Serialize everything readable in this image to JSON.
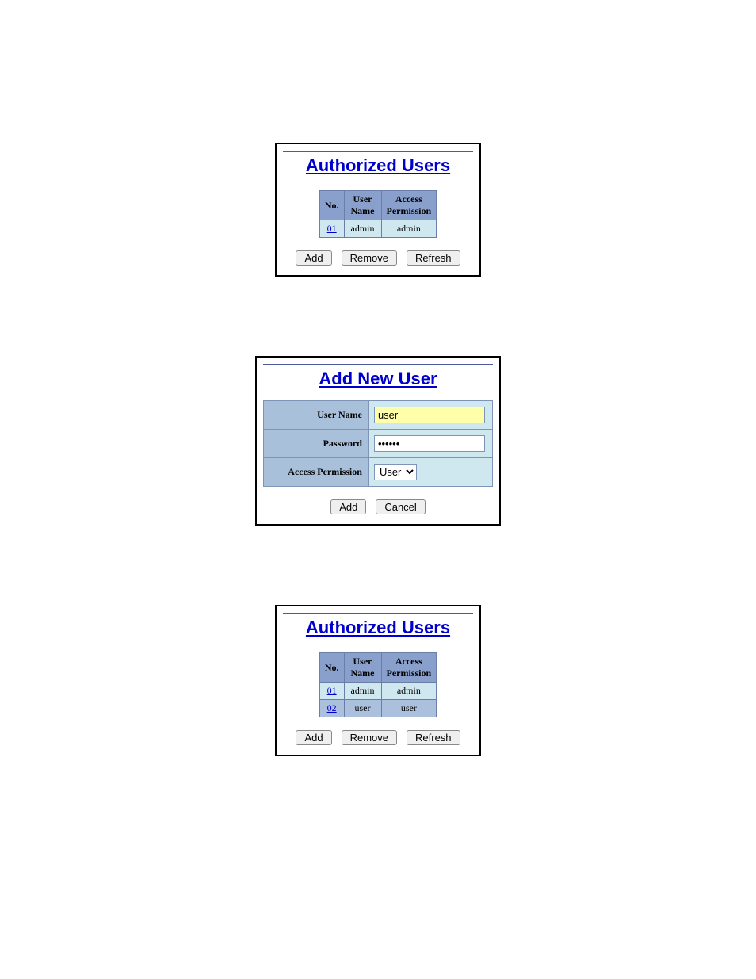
{
  "panel1": {
    "title": "Authorized Users",
    "columns": {
      "no": "No.",
      "user": "User\nName",
      "perm": "Access\nPermission"
    },
    "rows": [
      {
        "no": "01",
        "user": "admin",
        "perm": "admin"
      }
    ],
    "buttons": {
      "add": "Add",
      "remove": "Remove",
      "refresh": "Refresh"
    }
  },
  "panel2": {
    "title": "Add New User",
    "labels": {
      "username": "User Name",
      "password": "Password",
      "perm": "Access Permission"
    },
    "values": {
      "username": "user",
      "password": "••••••",
      "perm": "User"
    },
    "buttons": {
      "add": "Add",
      "cancel": "Cancel"
    }
  },
  "panel3": {
    "title": "Authorized Users",
    "columns": {
      "no": "No.",
      "user": "User\nName",
      "perm": "Access\nPermission"
    },
    "rows": [
      {
        "no": "01",
        "user": "admin",
        "perm": "admin"
      },
      {
        "no": "02",
        "user": "user",
        "perm": "user"
      }
    ],
    "buttons": {
      "add": "Add",
      "remove": "Remove",
      "refresh": "Refresh"
    }
  }
}
